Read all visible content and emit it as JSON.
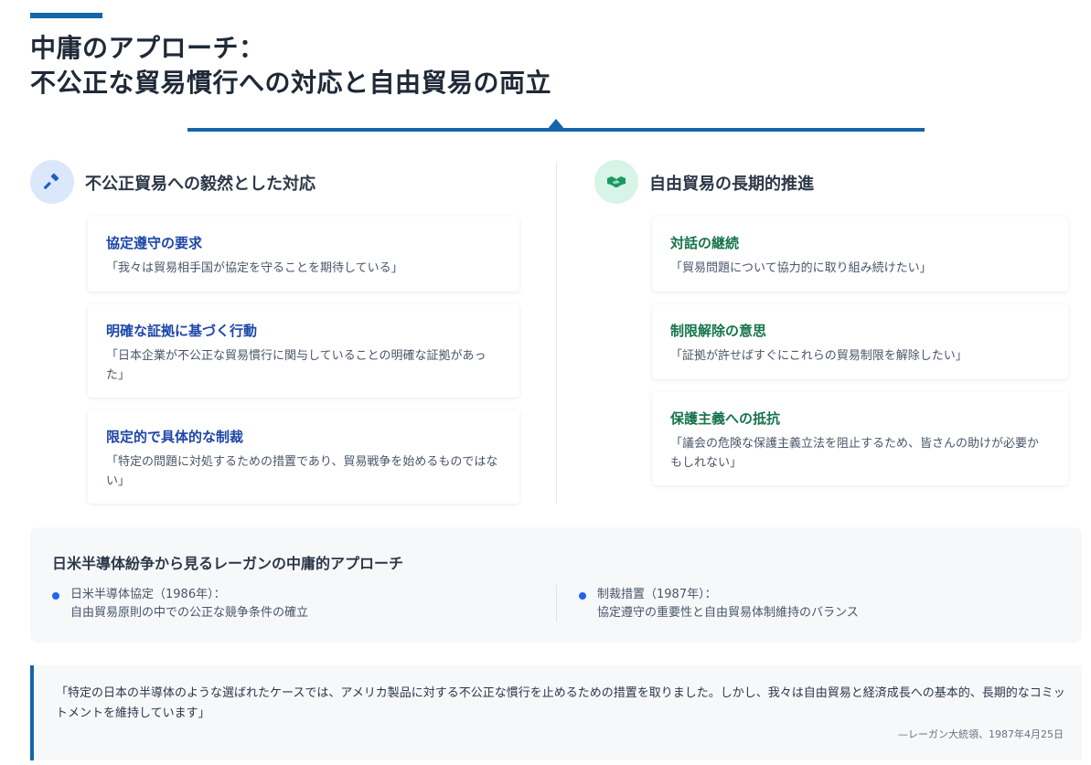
{
  "title": {
    "line1": "中庸のアプローチ：",
    "line2": "不公正な貿易慣行への対応と自由貿易の両立"
  },
  "left": {
    "icon": "gavel-icon",
    "heading": "不公正貿易への毅然とした対応",
    "cards": [
      {
        "title": "協定遵守の要求",
        "text": "「我々は貿易相手国が協定を守ることを期待している」"
      },
      {
        "title": "明確な証拠に基づく行動",
        "text": "「日本企業が不公正な貿易慣行に関与していることの明確な証拠があった」"
      },
      {
        "title": "限定的で具体的な制裁",
        "text": "「特定の問題に対処するための措置であり、貿易戦争を始めるものではない」"
      }
    ]
  },
  "right": {
    "icon": "handshake-icon",
    "heading": "自由貿易の長期的推進",
    "cards": [
      {
        "title": "対話の継続",
        "text": "「貿易問題について協力的に取り組み続けたい」"
      },
      {
        "title": "制限解除の意思",
        "text": "「証拠が許せばすぐにこれらの貿易制限を解除したい」"
      },
      {
        "title": "保護主義への抵抗",
        "text": "「議会の危険な保護主義立法を阻止するため、皆さんの助けが必要かもしれない」"
      }
    ]
  },
  "case_study": {
    "title": "日米半導体紛争から見るレーガンの中庸的アプローチ",
    "items": [
      {
        "label": "日米半導体協定（1986年）：",
        "desc": "自由貿易原則の中での公正な競争条件の確立"
      },
      {
        "label": "制裁措置（1987年）：",
        "desc": "協定遵守の重要性と自由貿易体制維持のバランス"
      }
    ]
  },
  "quote": {
    "text": "「特定の日本の半導体のような選ばれたケースでは、アメリカ製品に対する不公正な慣行を止めるための措置を取りました。しかし、我々は自由貿易と経済成長への基本的、長期的なコミットメントを維持しています」",
    "attribution": "—レーガン大統領、1987年4月25日"
  },
  "colors": {
    "accent": "#1565a8",
    "left_title": "#1e46a8",
    "right_title": "#16744c",
    "bullet": "#2563eb"
  }
}
